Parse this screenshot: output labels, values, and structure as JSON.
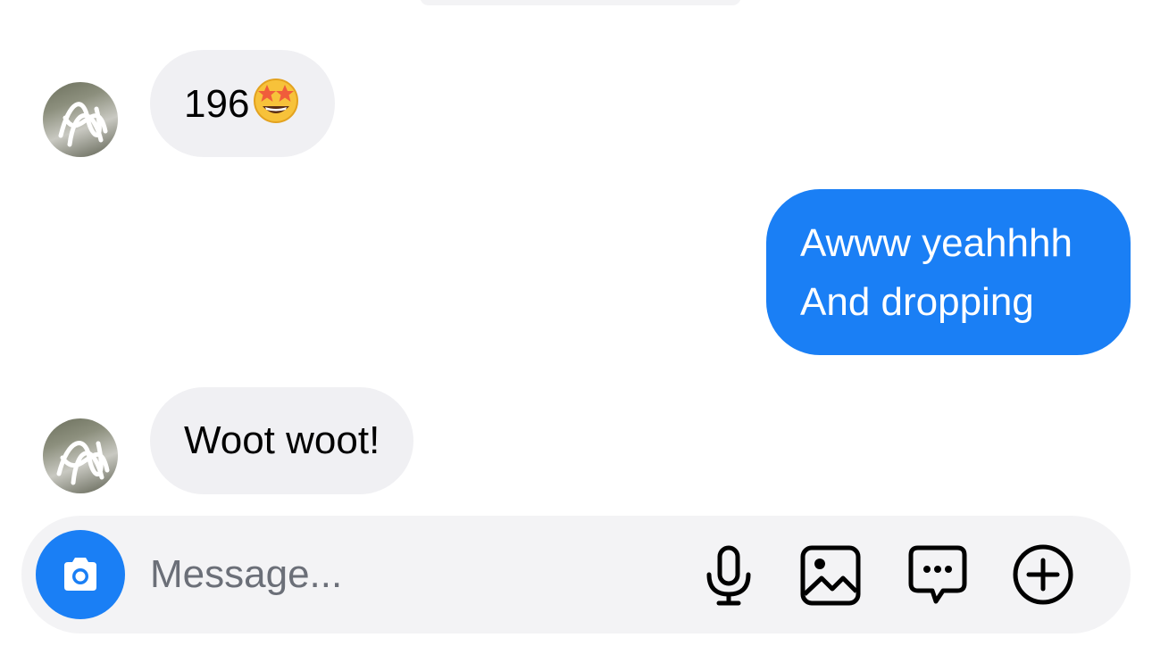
{
  "colors": {
    "accent": "#1a7ff5",
    "incoming_bubble": "#f0f0f3",
    "outgoing_text": "#ffffff",
    "composer_background": "#f3f3f5",
    "placeholder": "#6b6f78"
  },
  "messages": [
    {
      "direction": "incoming",
      "text": "196",
      "emoji": "star-struck-emoji"
    },
    {
      "direction": "outgoing",
      "lines": [
        "Awww yeahhhh",
        "And dropping"
      ]
    },
    {
      "direction": "incoming",
      "text": "Woot woot!"
    }
  ],
  "composer": {
    "placeholder": "Message...",
    "value": "",
    "icons": [
      "camera-icon",
      "microphone-icon",
      "gallery-icon",
      "sticker-chat-icon",
      "plus-circle-icon"
    ]
  }
}
